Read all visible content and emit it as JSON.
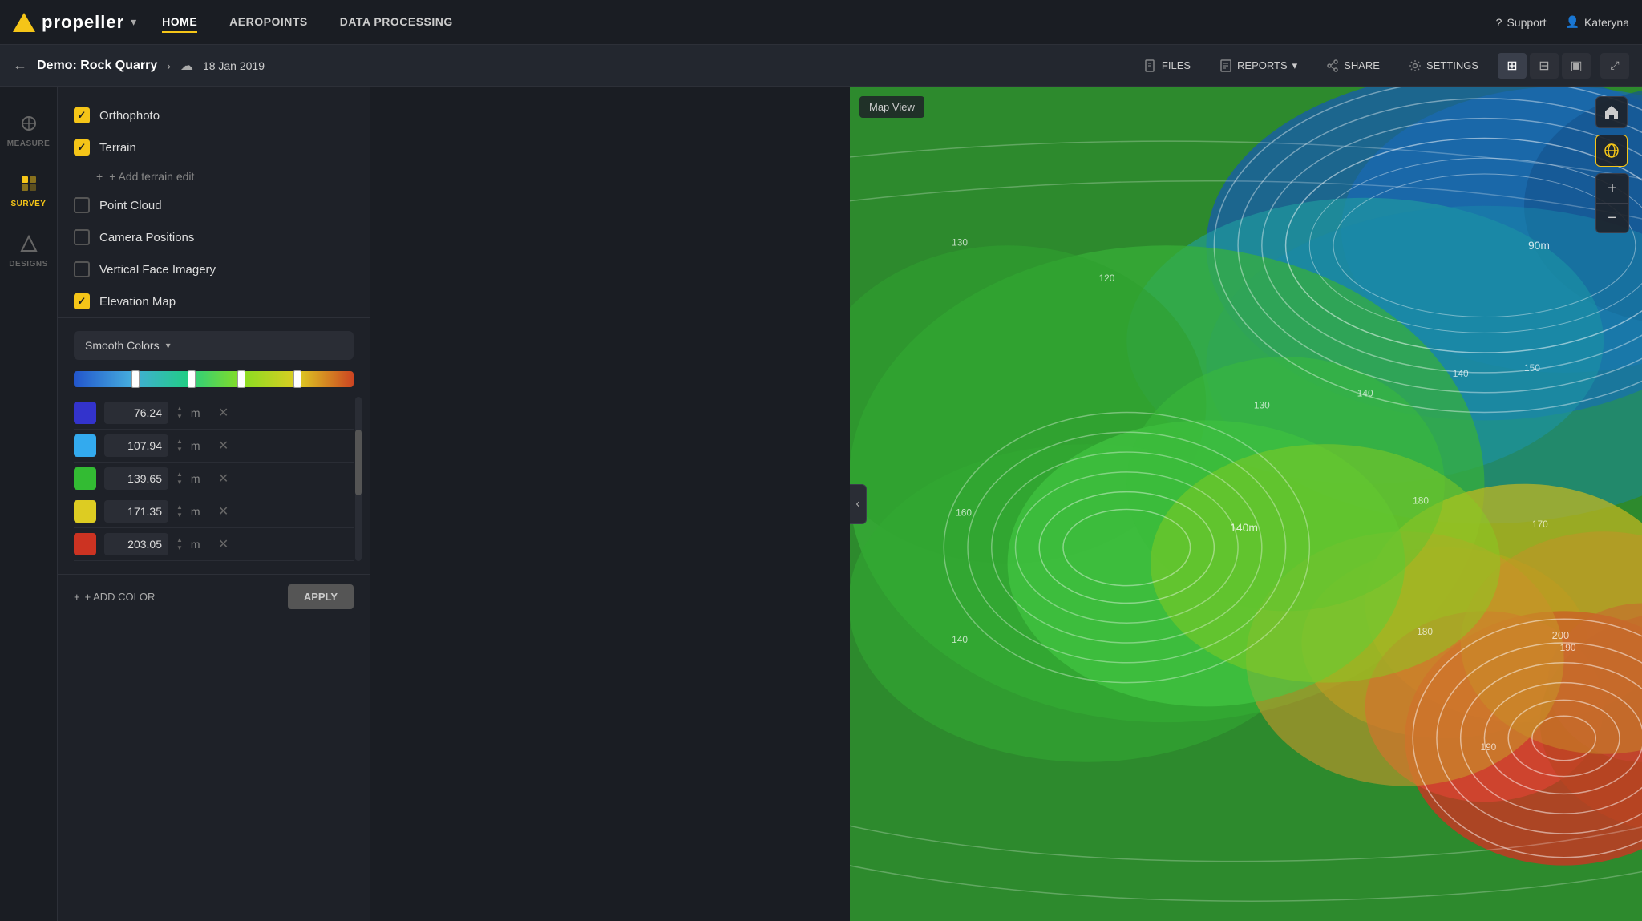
{
  "nav": {
    "logo": "propeller",
    "links": [
      {
        "label": "HOME",
        "active": true
      },
      {
        "label": "AEROPOINTS",
        "active": false
      },
      {
        "label": "DATA PROCESSING",
        "active": false
      }
    ],
    "support_label": "Support",
    "user_label": "Kateryna"
  },
  "secondary_bar": {
    "project": "Demo: Rock Quarry",
    "date": "18 Jan 2019",
    "actions": [
      {
        "label": "FILES",
        "icon": "file-icon"
      },
      {
        "label": "REPORTS",
        "icon": "report-icon"
      },
      {
        "label": "SHARE",
        "icon": "share-icon"
      },
      {
        "label": "SETTINGS",
        "icon": "settings-icon"
      }
    ]
  },
  "left_nav": [
    {
      "label": "MEASURE",
      "icon": "measure-icon",
      "active": false
    },
    {
      "label": "SURVEY",
      "icon": "survey-icon",
      "active": true
    },
    {
      "label": "DESIGNS",
      "icon": "designs-icon",
      "active": false
    }
  ],
  "layers": [
    {
      "label": "Orthophoto",
      "checked": true
    },
    {
      "label": "Terrain",
      "checked": true
    },
    {
      "label": "Point Cloud",
      "checked": false
    },
    {
      "label": "Camera Positions",
      "checked": false
    },
    {
      "label": "Vertical Face Imagery",
      "checked": false
    },
    {
      "label": "Elevation Map",
      "checked": true
    }
  ],
  "add_terrain_label": "+ Add terrain edit",
  "elevation": {
    "color_mode": "Smooth Colors",
    "gradient_stops": [
      0.22,
      0.42,
      0.6,
      0.8
    ],
    "colors": [
      {
        "hex": "#3333cc",
        "value": "76.24",
        "unit": "m"
      },
      {
        "hex": "#33aaee",
        "value": "107.94",
        "unit": "m"
      },
      {
        "hex": "#33bb33",
        "value": "139.65",
        "unit": "m"
      },
      {
        "hex": "#ddcc22",
        "value": "171.35",
        "unit": "m"
      },
      {
        "hex": "#cc3322",
        "value": "203.05",
        "unit": "m"
      }
    ]
  },
  "buttons": {
    "add_color": "+ ADD COLOR",
    "apply": "APPLY"
  },
  "map": {
    "view_label": "Map View"
  }
}
